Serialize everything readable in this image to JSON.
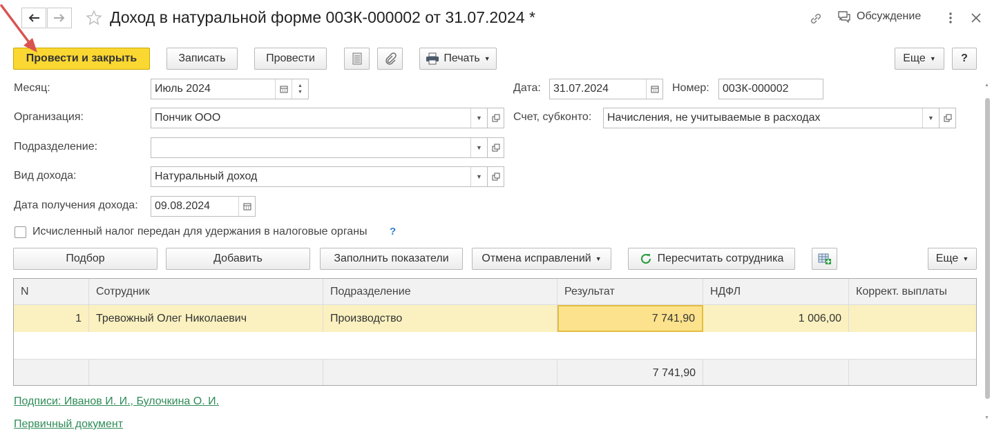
{
  "window": {
    "title": "Доход в натуральной форме 00ЗК-000002 от 31.07.2024 *",
    "discussion_label": "Обсуждение"
  },
  "toolbar": {
    "post_close": "Провести и закрыть",
    "save": "Записать",
    "post": "Провести",
    "print": "Печать",
    "more": "Еще",
    "help": "?"
  },
  "form": {
    "month_label": "Месяц:",
    "month_value": "Июль 2024",
    "date_label": "Дата:",
    "date_value": "31.07.2024",
    "number_label": "Номер:",
    "number_value": "00ЗК-000002",
    "org_label": "Организация:",
    "org_value": "Пончик ООО",
    "account_label": "Счет, субконто:",
    "account_value": "Начисления, не учитываемые в расходах",
    "dept_label": "Подразделение:",
    "dept_value": "",
    "income_type_label": "Вид дохода:",
    "income_type_value": "Натуральный доход",
    "income_date_label": "Дата получения дохода:",
    "income_date_value": "09.08.2024",
    "tax_checkbox_label": "Исчисленный налог передан для удержания в налоговые органы",
    "tax_checkbox_checked": false,
    "help_mark": "?"
  },
  "table_toolbar": {
    "select": "Подбор",
    "add": "Добавить",
    "fill": "Заполнить показатели",
    "cancel_fix": "Отмена исправлений",
    "recalc": "Пересчитать сотрудника",
    "more": "Еще"
  },
  "table": {
    "columns": [
      "N",
      "Сотрудник",
      "Подразделение",
      "Результат",
      "НДФЛ",
      "Коррект. выплаты"
    ],
    "rows": [
      {
        "n": "1",
        "employee": "Тревожный Олег Николаевич",
        "dept": "Производство",
        "result": "7 741,90",
        "ndfl": "1 006,00",
        "correction": ""
      }
    ],
    "totals": {
      "result": "7 741,90"
    }
  },
  "footer": {
    "signatures": "Подписи: Иванов И. И., Булочкина О. И.",
    "primary_doc": "Первичный документ"
  },
  "colors": {
    "primary_button": "#fad731",
    "selected_row": "#fbf1c0",
    "link": "#2e8b57",
    "arrow": "#d9534f"
  }
}
